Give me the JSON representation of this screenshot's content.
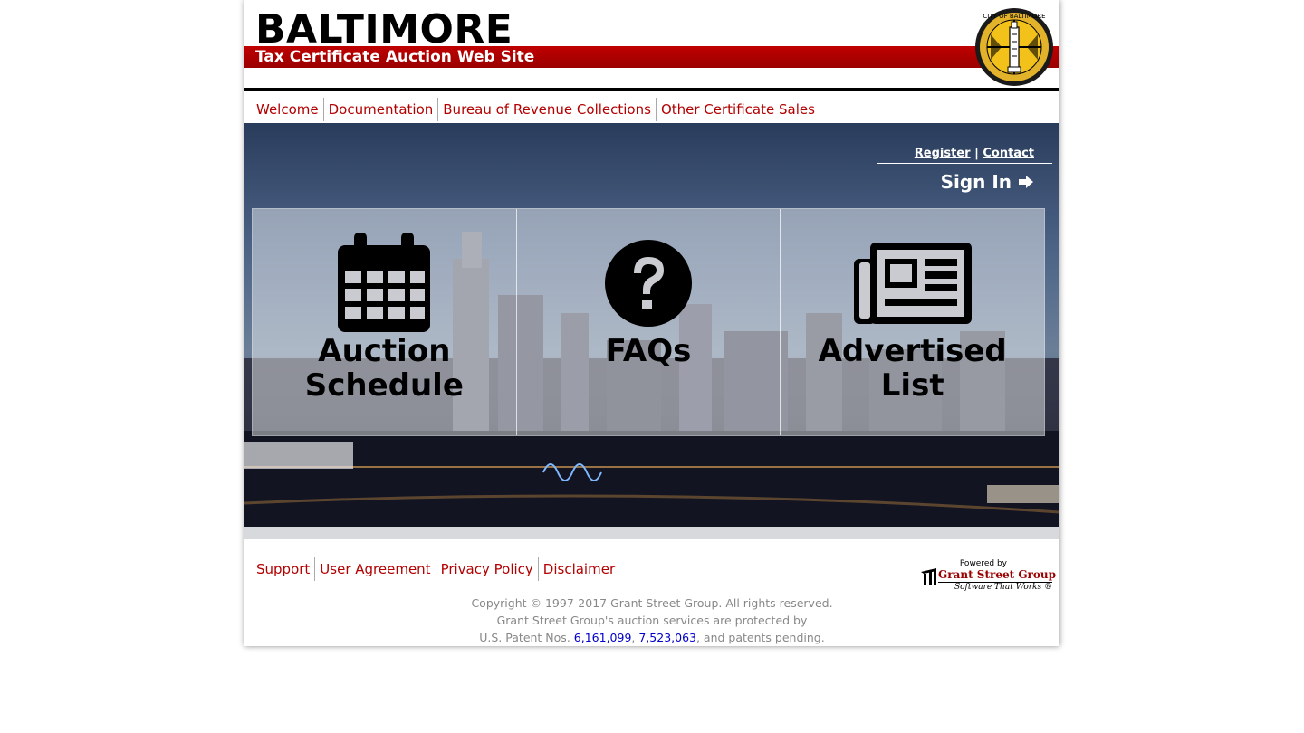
{
  "header": {
    "brand": "BALTIMORE",
    "subtitle": "Tax Certificate Auction Web Site",
    "seal_text": "CITY OF BALTIMORE",
    "accent_color": "#b30000"
  },
  "nav": {
    "items": [
      {
        "label": "Welcome"
      },
      {
        "label": "Documentation"
      },
      {
        "label": "Bureau of Revenue Collections"
      },
      {
        "label": "Other Certificate Sales"
      }
    ]
  },
  "account": {
    "register": "Register",
    "separator": "|",
    "contact": "Contact",
    "sign_in": "Sign In"
  },
  "tiles": [
    {
      "line1": "Auction",
      "line2": "Schedule",
      "icon": "calendar-icon"
    },
    {
      "line1": "FAQs",
      "line2": "",
      "icon": "question-circle-icon"
    },
    {
      "line1": "Advertised",
      "line2": "List",
      "icon": "newspaper-icon"
    }
  ],
  "footer": {
    "links": [
      {
        "label": "Support"
      },
      {
        "label": "User Agreement"
      },
      {
        "label": "Privacy Policy"
      },
      {
        "label": "Disclaimer"
      }
    ],
    "powered_by": "Powered by",
    "gsg_name": "Grant Street Group",
    "gsg_tagline": "Software That Works ®",
    "copyright_line1": "Copyright © 1997-2017 Grant Street Group. All rights reserved.",
    "copyright_line2": "Grant Street Group's auction services are protected by",
    "patent_prefix": "U.S. Patent Nos. ",
    "patent1": "6,161,099",
    "patent_sep": ", ",
    "patent2": "7,523,063",
    "patent_suffix": ", and patents pending."
  }
}
